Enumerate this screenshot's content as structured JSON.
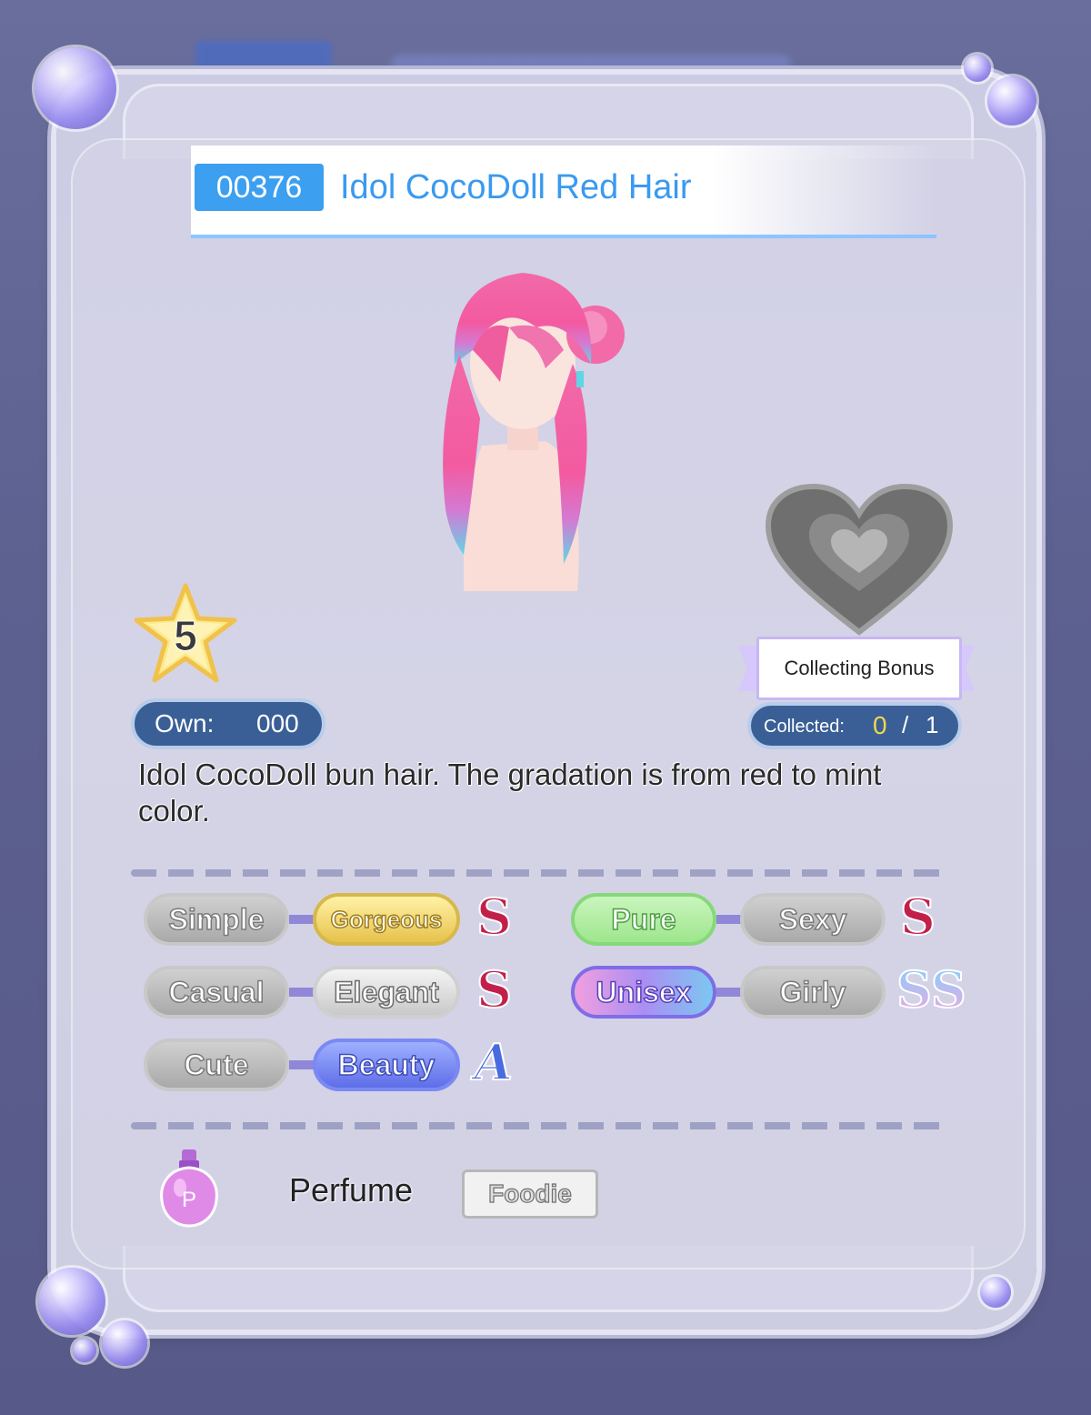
{
  "item": {
    "id": "00376",
    "name": "Idol CocoDoll Red Hair",
    "rarity": "5",
    "own_label": "Own:",
    "own_value": "000",
    "description": "Idol CocoDoll bun hair. The gradation is from red to mint color."
  },
  "collecting_bonus": {
    "label": "Collecting Bonus",
    "collected_label": "Collected:",
    "collected_current": "0",
    "separator": "/",
    "collected_total": "1"
  },
  "styles": {
    "pairs": [
      {
        "left": "Simple",
        "right": "Gorgeous",
        "active": "right",
        "grade": "S"
      },
      {
        "left": "Casual",
        "right": "Elegant",
        "active": "right",
        "grade": "S"
      },
      {
        "left": "Cute",
        "right": "Beauty",
        "active": "right",
        "grade": "A"
      },
      {
        "left": "Pure",
        "right": "Sexy",
        "active": "left",
        "grade": "S"
      },
      {
        "left": "Unisex",
        "right": "Girly",
        "active": "left",
        "grade": "SS"
      }
    ]
  },
  "perfume": {
    "label": "Perfume",
    "icon_letter": "P",
    "tag": "Foodie"
  },
  "colors": {
    "accent_blue": "#3c9ff0",
    "grade_s": "#c2204a",
    "grade_a": "#4a6be0",
    "hair_pink": "#f26aa8",
    "hair_mint": "#5fd6e6"
  }
}
